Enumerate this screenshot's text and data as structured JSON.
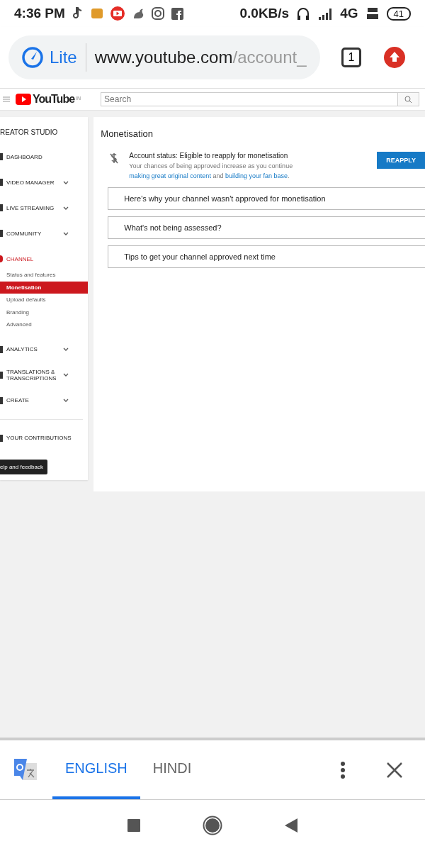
{
  "status_bar": {
    "time": "4:36 PM",
    "data_rate": "0.0KB/s",
    "network_type": "4G",
    "battery": "41"
  },
  "browser": {
    "mode": "Lite",
    "url_host": "www.youtube.com",
    "url_path": "/account_",
    "tab_count": "1"
  },
  "youtube_header": {
    "logo": "YouTube",
    "region": "IN",
    "search": {
      "placeholder": "Search"
    }
  },
  "sidebar": {
    "title": "REATOR STUDIO",
    "items": [
      {
        "label": "DASHBOARD",
        "expandable": false,
        "selected": false
      },
      {
        "label": "VIDEO MANAGER",
        "expandable": true,
        "selected": false
      },
      {
        "label": "LIVE STREAMING",
        "expandable": true,
        "selected": false
      },
      {
        "label": "COMMUNITY",
        "expandable": true,
        "selected": false
      },
      {
        "label": "CHANNEL",
        "expandable": false,
        "selected": true,
        "children": [
          {
            "label": "Status and features",
            "selected": false
          },
          {
            "label": "Monetisation",
            "selected": true
          },
          {
            "label": "Upload defaults",
            "selected": false
          },
          {
            "label": "Branding",
            "selected": false
          },
          {
            "label": "Advanced",
            "selected": false
          }
        ]
      },
      {
        "label": "ANALYTICS",
        "expandable": true,
        "selected": false
      },
      {
        "label": "TRANSLATIONS & TRANSCRIPTIONS",
        "expandable": true,
        "selected": false
      },
      {
        "label": "CREATE",
        "expandable": true,
        "selected": false
      }
    ],
    "contributions": "YOUR CONTRIBUTIONS",
    "help_button": "elp and feedback"
  },
  "main": {
    "title": "Monetisation",
    "status": "Account status: Eligible to reapply for monetisation",
    "description": [
      {
        "text": "Your chances of being approved increase as you continue ",
        "link": false
      },
      {
        "text": "making great original content",
        "link": true
      },
      {
        "text": " and ",
        "link": false
      },
      {
        "text": "building your fan base",
        "link": true
      },
      {
        "text": ".",
        "link": false
      }
    ],
    "button": "REAPPLY",
    "sections": [
      "Here's why your channel wasn't approved for monetisation",
      "What's not being assessed?",
      "Tips to get your channel approved next time"
    ]
  },
  "translate_bar": {
    "tabs": [
      {
        "label": "ENGLISH",
        "selected": true
      },
      {
        "label": "HINDI",
        "selected": false
      }
    ]
  }
}
